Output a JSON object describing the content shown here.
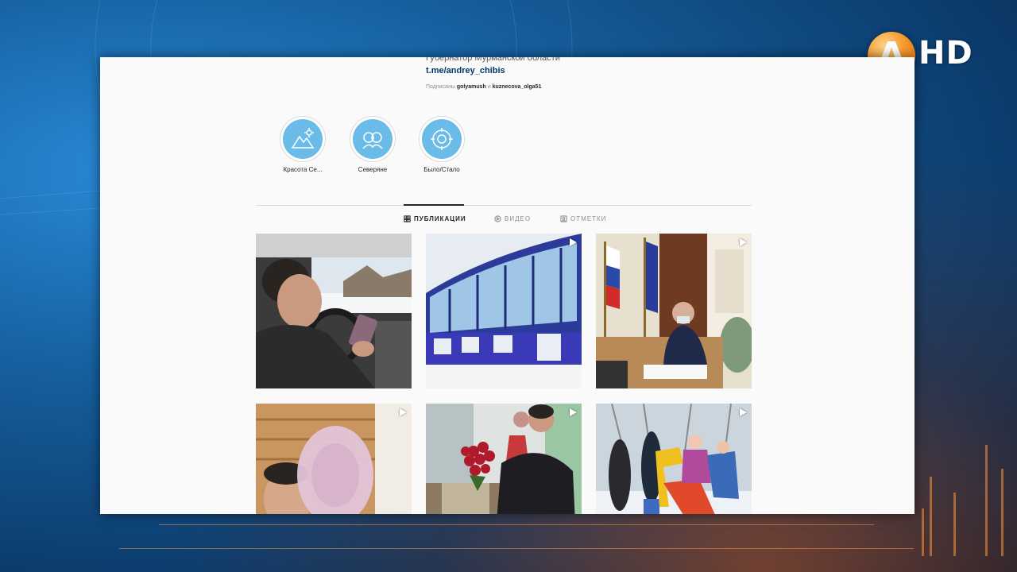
{
  "channel": {
    "logo_letter": "А",
    "hd_label": "HD"
  },
  "profile": {
    "role": "Губернатор Мурманской области",
    "link": "t.me/andrey_chibis",
    "followed_prefix": "Подписаны",
    "followed_user1": "golyamush",
    "followed_and": "и",
    "followed_user2": "kuznecova_olga51"
  },
  "highlights": [
    {
      "label": "Красота Се...",
      "icon": "mountain-icon"
    },
    {
      "label": "Северяне",
      "icon": "people-icon"
    },
    {
      "label": "Было/Стало",
      "icon": "rotate-icon"
    }
  ],
  "tabs": [
    {
      "label": "ПУБЛИКАЦИИ",
      "icon": "grid-icon",
      "active": true
    },
    {
      "label": "ВИДЕО",
      "icon": "video-icon",
      "active": false
    },
    {
      "label": "ОТМЕТКИ",
      "icon": "tag-icon",
      "active": false
    }
  ],
  "colors": {
    "highlight_blue": "#6bbbe8",
    "link": "#00376b",
    "logo_orange": "#f59a2c"
  }
}
